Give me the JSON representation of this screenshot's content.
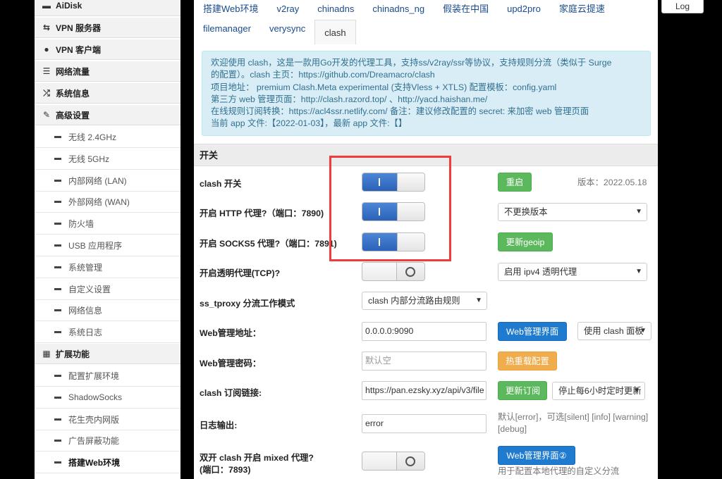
{
  "sidebar": {
    "menu": [
      {
        "label": "AiDisk",
        "icon": "drive-icon"
      },
      {
        "label": "VPN 服务器",
        "icon": "vpn-server-icon"
      },
      {
        "label": "VPN 客户端",
        "icon": "globe-icon"
      },
      {
        "label": "网络流量",
        "icon": "traffic-icon"
      },
      {
        "label": "系统信息",
        "icon": "shuffle-icon"
      },
      {
        "label": "高级设置",
        "icon": "wrench-icon"
      }
    ],
    "advanced": [
      "无线 2.4GHz",
      "无线 5GHz",
      "内部网络 (LAN)",
      "外部网络 (WAN)",
      "防火墙",
      "USB 应用程序",
      "系统管理",
      "自定义设置",
      "网络信息",
      "系统日志"
    ],
    "ext_title": "扩展功能",
    "ext_icon": "grid-icon",
    "extensions": [
      "配置扩展环境",
      "ShadowSocks",
      "花生壳内网版",
      "广告屏蔽功能",
      "搭建Web环境"
    ]
  },
  "tabs": {
    "row1": [
      "搭建Web环境",
      "v2ray",
      "chinadns",
      "chinadns_ng",
      "假装在中国",
      "upd2pro",
      "家庭云提速"
    ],
    "row2": [
      "filemanager",
      "verysync",
      "clash"
    ],
    "active": "clash"
  },
  "info": {
    "lines": [
      "欢迎使用 clash，这是一款用Go开发的代理工具，支持ss/v2ray/ssr等协议，支持规则分流（类似于 Surge",
      "的配置）。clash 主页：https://github.com/Dreamacro/clash",
      "项目地址： premium Clash.Meta experimental (支持Vless + XTLS) 配置模板：config.yaml",
      "第三方 web 管理页面：http://clash.razord.top/ 、http://yacd.haishan.me/",
      "在线规则订阅转换：https://acl4ssr.netlify.com/ 备注：建议修改配置的 secret: 来加密 web 管理页面",
      "当前 app 文件:【2022-01-03】，最新 app 文件:【】"
    ]
  },
  "section_title": "开关",
  "form": {
    "clash_switch": {
      "label": "clash 开关",
      "on": true
    },
    "restart_btn": "重启",
    "version": "版本：2022.05.18",
    "http_proxy": {
      "label": "开启 HTTP 代理?（端口：7890)",
      "on": true
    },
    "version_select": "不更换版本",
    "socks5_proxy": {
      "label": "开启 SOCKS5 代理?（端口：7891)",
      "on": true
    },
    "geoip_btn": "更新geoip",
    "transparent": {
      "label": "开启透明代理(TCP)?",
      "on": false
    },
    "ipv4_select": "启用 ipv4 透明代理",
    "tproxy": {
      "label": "ss_tproxy 分流工作模式",
      "value": "clash 内部分流路由规则"
    },
    "web_addr": {
      "label": "Web管理地址：",
      "value": "0.0.0.0:9090",
      "button": "Web管理界面",
      "select": "使用 clash 面板"
    },
    "web_pwd": {
      "label": "Web管理密码：",
      "placeholder": "默认空",
      "button": "热重载配置"
    },
    "subscribe": {
      "label": "clash 订阅链接:",
      "value": "https://pan.ezsky.xyz/api/v3/file",
      "button": "更新订阅",
      "select": "停止每6小时定时更新"
    },
    "log": {
      "label": "日志输出:",
      "value": "error",
      "hint1": "默认[error]，可选[silent] [info] [warning]",
      "hint2": "[debug]"
    },
    "mixed": {
      "label1": "双开 clash 开启 mixed 代理?",
      "label2": "(端口：7893)",
      "on": false,
      "button": "Web管理界面②",
      "hint": "用于配置本地代理的自定义分流"
    }
  },
  "log_button": "Log"
}
